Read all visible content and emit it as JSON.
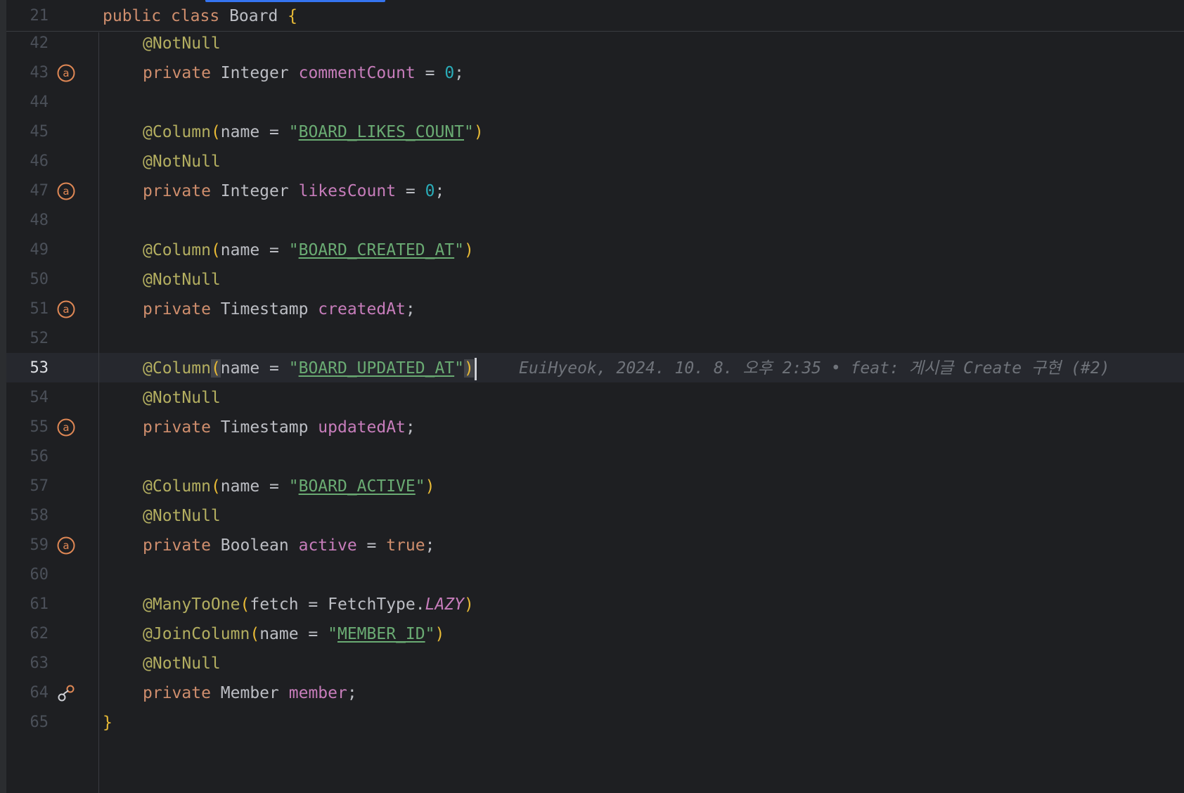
{
  "editor": {
    "sticky_line": {
      "number": "21",
      "public": "public",
      "class": "class",
      "name": "Board",
      "brace": "{"
    },
    "lines": [
      {
        "n": "42"
      },
      {
        "n": "43"
      },
      {
        "n": "44"
      },
      {
        "n": "45"
      },
      {
        "n": "46"
      },
      {
        "n": "47"
      },
      {
        "n": "48"
      },
      {
        "n": "49"
      },
      {
        "n": "50"
      },
      {
        "n": "51"
      },
      {
        "n": "52"
      },
      {
        "n": "53"
      },
      {
        "n": "54"
      },
      {
        "n": "55"
      },
      {
        "n": "56"
      },
      {
        "n": "57"
      },
      {
        "n": "58"
      },
      {
        "n": "59"
      },
      {
        "n": "60"
      },
      {
        "n": "61"
      },
      {
        "n": "62"
      },
      {
        "n": "63"
      },
      {
        "n": "64"
      },
      {
        "n": "65"
      }
    ],
    "tokens": {
      "not_null": "@NotNull",
      "column": "@Column",
      "many_to_one": "@ManyToOne",
      "join_column": "@JoinColumn",
      "private": "private",
      "integer": "Integer",
      "timestamp": "Timestamp",
      "boolean": "Boolean",
      "member_type": "Member",
      "name_eq": "name = ",
      "fetch_eq": "fetch = ",
      "eq": " = ",
      "semi": ";",
      "quote": "\"",
      "open_paren": "(",
      "close_paren": ")",
      "comment_count": "commentCount",
      "likes_count": "likesCount",
      "created_at": "createdAt",
      "updated_at": "updatedAt",
      "active": "active",
      "member": "member",
      "zero": "0",
      "true": "true",
      "fetch_type": "FetchType.",
      "lazy": "LAZY",
      "close_brace": "}",
      "str_likes": "BOARD_LIKES_COUNT",
      "str_created": "BOARD_CREATED_AT",
      "str_updated": "BOARD_UPDATED_AT",
      "str_active": "BOARD_ACTIVE",
      "str_member_id": "MEMBER_ID"
    },
    "current_line": "53",
    "blame": "EuiHyeok, 2024. 10. 8. 오후 2:35 • feat: 게시글 Create 구현 (#2)",
    "gutter_icons": {
      "field_annotation": "at-sign-icon",
      "relation": "entity-relation-icon"
    }
  },
  "colors": {
    "background": "#1e1f22",
    "keyword": "#cf8e6d",
    "annotation": "#b3ae60",
    "field": "#c77dbb",
    "number": "#2aacb8",
    "string": "#6aab73",
    "brace": "#e8ba36",
    "accent": "#3574f0"
  }
}
